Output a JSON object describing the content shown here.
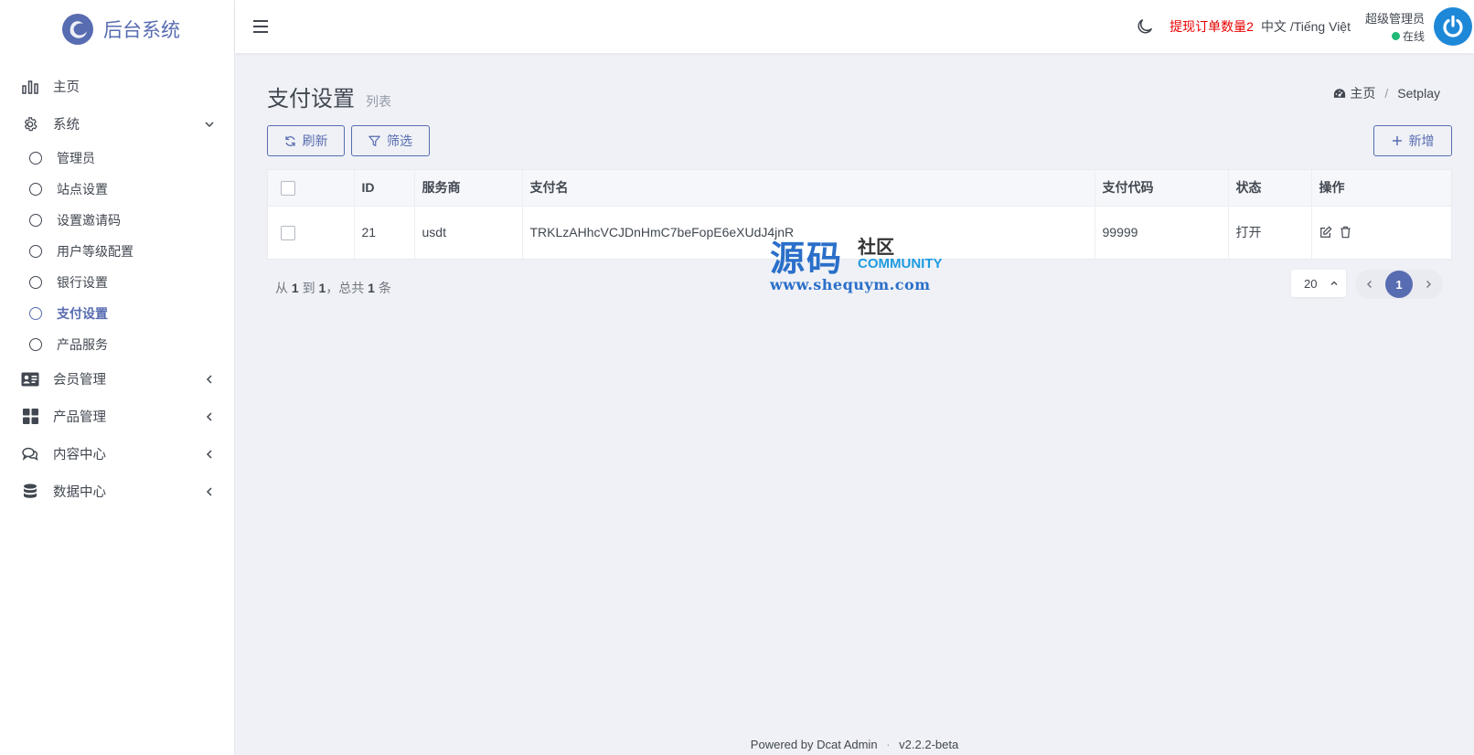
{
  "brand": {
    "title": "后台系统"
  },
  "sidebar": {
    "items": [
      {
        "label": "主页",
        "icon": "bar-chart-icon"
      },
      {
        "label": "系统",
        "icon": "gear-icon",
        "expanded": true,
        "children": [
          {
            "label": "管理员"
          },
          {
            "label": "站点设置"
          },
          {
            "label": "设置邀请码"
          },
          {
            "label": "用户等级配置"
          },
          {
            "label": "银行设置"
          },
          {
            "label": "支付设置",
            "active": true
          },
          {
            "label": "产品服务"
          }
        ]
      },
      {
        "label": "会员管理",
        "icon": "id-card-icon"
      },
      {
        "label": "产品管理",
        "icon": "grid-icon"
      },
      {
        "label": "内容中心",
        "icon": "comments-icon"
      },
      {
        "label": "数据中心",
        "icon": "database-icon"
      }
    ]
  },
  "topbar": {
    "withdraw_label": "提现订单数量2",
    "lang_label": "中文 /Tiếng Việt",
    "user_name": "超级管理员",
    "user_status": "在线"
  },
  "page": {
    "title": "支付设置",
    "subtitle": "列表",
    "breadcrumb": {
      "home": "主页",
      "current": "Setplay"
    }
  },
  "toolbar": {
    "refresh_label": "刷新",
    "filter_label": "筛选",
    "add_label": "新增"
  },
  "table": {
    "headers": [
      "ID",
      "服务商",
      "支付名",
      "支付代码",
      "状态",
      "操作"
    ],
    "rows": [
      {
        "id": "21",
        "provider": "usdt",
        "name": "TRKLzAHhcVCJDnHmC7beFopE6eXUdJ4jnR",
        "code": "99999",
        "status": "打开"
      }
    ]
  },
  "pagination": {
    "info_prefix": "从",
    "from": "1",
    "to_word": "到",
    "to": "1",
    "total_word": "，总共",
    "total": "1",
    "unit": "条",
    "per_page": "20",
    "current_page": "1"
  },
  "watermark": {
    "big": "源码",
    "small": "社区",
    "community": "COMMUNITY",
    "url": "www.shequym.com"
  },
  "footer": {
    "powered_prefix": "Powered by",
    "powered_name": "Dcat Admin",
    "version": "v2.2.2-beta"
  },
  "colors": {
    "primary": "#586cb1",
    "danger": "#e60000",
    "online": "#21b978",
    "avatar": "#1e88d8"
  }
}
